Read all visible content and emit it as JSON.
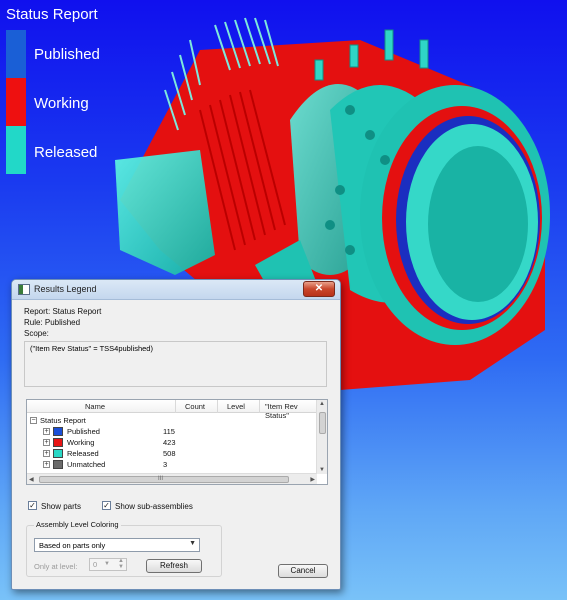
{
  "viewport_legend": {
    "title": "Status Report",
    "items": [
      {
        "label": "Published",
        "color": "#1a5fd6"
      },
      {
        "label": "Working",
        "color": "#ee1010"
      },
      {
        "label": "Released",
        "color": "#22d8c8"
      }
    ]
  },
  "dialog": {
    "title": "Results Legend",
    "close_label": "✕",
    "report_line": "Report: Status Report",
    "rule_line": "Rule: Published",
    "scope_label": "Scope:",
    "scope_text": "(\"Item Rev Status\" = TSS4published)",
    "tree": {
      "columns": [
        "Name",
        "Count",
        "Level",
        "\"Item Rev Status\""
      ],
      "root": "Status Report",
      "rows": [
        {
          "name": "Published",
          "count": "115",
          "color": "#1a4fd8"
        },
        {
          "name": "Working",
          "count": "423",
          "color": "#e81414"
        },
        {
          "name": "Released",
          "count": "508",
          "color": "#2ad8c6"
        },
        {
          "name": "Unmatched",
          "count": "3",
          "color": "#6b6b6b"
        }
      ],
      "hscroll_label": "III"
    },
    "show_parts_label": "Show parts",
    "show_subassemblies_label": "Show sub-assemblies",
    "group_title": "Assembly Level Coloring",
    "coloring_selected": "Based on parts only",
    "only_at_level_label": "Only at level:",
    "level_value": "0",
    "refresh_label": "Refresh",
    "cancel_label": "Cancel"
  }
}
